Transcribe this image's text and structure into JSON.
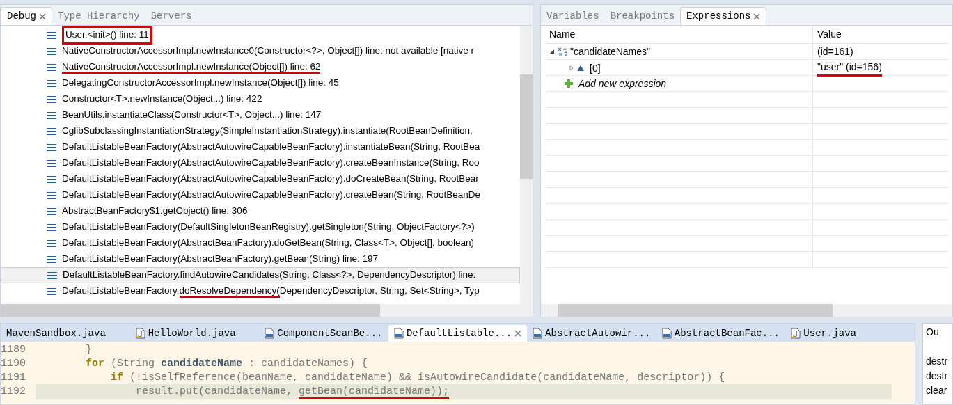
{
  "debug_panel": {
    "tabs": [
      {
        "label": "Debug",
        "selected": true,
        "closable": true
      },
      {
        "label": "Type Hierarchy",
        "selected": false,
        "closable": false
      },
      {
        "label": "Servers",
        "selected": false,
        "closable": false
      }
    ],
    "frames": [
      {
        "parts": [
          {
            "text": "User.<init>() line: 11",
            "underlined": false
          }
        ],
        "boxed": true,
        "selected": false
      },
      {
        "parts": [
          {
            "text": "NativeConstructorAccessorImpl.newInstance0(Constructor<?>, Object[]) line: not available [native r",
            "underlined": false
          }
        ],
        "boxed": false,
        "selected": false
      },
      {
        "parts": [
          {
            "text": "NativeConstructorAccessorImpl.newInstance(Object[]) line: 62",
            "underlined": true
          }
        ],
        "boxed": false,
        "selected": false
      },
      {
        "parts": [
          {
            "text": "DelegatingConstructorAccessorImpl.newInstance(Object[]) line: 45",
            "underlined": false
          }
        ],
        "boxed": false,
        "selected": false
      },
      {
        "parts": [
          {
            "text": "Constructor<T>.newInstance(Object...) line: 422",
            "underlined": false
          }
        ],
        "boxed": false,
        "selected": false
      },
      {
        "parts": [
          {
            "text": "BeanUtils.instantiateClass(Constructor<T>, Object...) line: 147",
            "underlined": false
          }
        ],
        "boxed": false,
        "selected": false
      },
      {
        "parts": [
          {
            "text": "CglibSubclassingInstantiationStrategy(SimpleInstantiationStrategy).instantiate(RootBeanDefinition,",
            "underlined": false
          }
        ],
        "boxed": false,
        "selected": false
      },
      {
        "parts": [
          {
            "text": "DefaultListableBeanFactory(AbstractAutowireCapableBeanFactory).instantiateBean(String, RootBea",
            "underlined": false
          }
        ],
        "boxed": false,
        "selected": false
      },
      {
        "parts": [
          {
            "text": "DefaultListableBeanFactory(AbstractAutowireCapableBeanFactory).createBeanInstance(String, Roo",
            "underlined": false
          }
        ],
        "boxed": false,
        "selected": false
      },
      {
        "parts": [
          {
            "text": "DefaultListableBeanFactory(AbstractAutowireCapableBeanFactory).doCreateBean(String, RootBear",
            "underlined": false
          }
        ],
        "boxed": false,
        "selected": false
      },
      {
        "parts": [
          {
            "text": "DefaultListableBeanFactory(AbstractAutowireCapableBeanFactory).createBean(String, RootBeanDe",
            "underlined": false
          }
        ],
        "boxed": false,
        "selected": false
      },
      {
        "parts": [
          {
            "text": "AbstractBeanFactory$1.getObject() line: 306",
            "underlined": false
          }
        ],
        "boxed": false,
        "selected": false
      },
      {
        "parts": [
          {
            "text": "DefaultListableBeanFactory(DefaultSingletonBeanRegistry).getSingleton(String, ObjectFactory<?>)",
            "underlined": false
          }
        ],
        "boxed": false,
        "selected": false
      },
      {
        "parts": [
          {
            "text": "DefaultListableBeanFactory(AbstractBeanFactory).doGetBean(String, Class<T>, Object[], boolean)",
            "underlined": false
          }
        ],
        "boxed": false,
        "selected": false
      },
      {
        "parts": [
          {
            "text": "DefaultListableBeanFactory(AbstractBeanFactory).getBean(String) line: 197",
            "underlined": false
          }
        ],
        "boxed": false,
        "selected": false
      },
      {
        "parts": [
          {
            "text": "DefaultListableBeanFactory.findAutowireCandidates(String, Class<?>, DependencyDescriptor) line:",
            "underlined": false
          }
        ],
        "boxed": false,
        "selected": true
      },
      {
        "parts": [
          {
            "text": "DefaultListableBeanFactory.",
            "underlined": false
          },
          {
            "text": "doResolveDependency(",
            "underlined": true
          },
          {
            "text": "DependencyDescriptor, String, Set<String>, Typ",
            "underlined": false
          }
        ],
        "boxed": false,
        "selected": false
      }
    ]
  },
  "expressions_panel": {
    "tabs": [
      {
        "label": "Variables",
        "selected": false,
        "closable": false
      },
      {
        "label": "Breakpoints",
        "selected": false,
        "closable": false
      },
      {
        "label": "Expressions",
        "selected": true,
        "closable": true
      }
    ],
    "columns": [
      "Name",
      "Value"
    ],
    "rows": [
      {
        "kind": "expression",
        "name": "\"candidateNames\"",
        "value": "(id=161)",
        "expanded": true,
        "underlined": false
      },
      {
        "kind": "element",
        "name": "[0]",
        "value": "\"user\" (id=156)",
        "expanded": false,
        "underlined": true
      },
      {
        "kind": "add",
        "name": "Add new expression"
      }
    ]
  },
  "editor": {
    "tabs": [
      {
        "label": "MavenSandbox.java",
        "kind": "java",
        "selected": false
      },
      {
        "label": "HelloWorld.java",
        "kind": "java-warning",
        "selected": false
      },
      {
        "label": "ComponentScanBe...",
        "kind": "class",
        "selected": false
      },
      {
        "label": "DefaultListable...",
        "kind": "class",
        "selected": true
      },
      {
        "label": "AbstractAutowir...",
        "kind": "class",
        "selected": false
      },
      {
        "label": "AbstractBeanFac...",
        "kind": "class",
        "selected": false
      },
      {
        "label": "User.java",
        "kind": "java-warning",
        "selected": false
      }
    ],
    "lines": [
      {
        "number": "1189",
        "current": false,
        "segments": [
          {
            "text": "        }",
            "kind": "plain",
            "underlined": false
          }
        ]
      },
      {
        "number": "1190",
        "current": false,
        "segments": [
          {
            "text": "        for",
            "kind": "keyword",
            "underlined": false
          },
          {
            "text": " (String ",
            "kind": "plain",
            "underlined": false
          },
          {
            "text": "candidateName",
            "kind": "variable",
            "underlined": false
          },
          {
            "text": " : candidateNames) {",
            "kind": "plain",
            "underlined": false
          }
        ]
      },
      {
        "number": "1191",
        "current": false,
        "segments": [
          {
            "text": "            if",
            "kind": "keyword",
            "underlined": false
          },
          {
            "text": " (!isSelfReference(beanName, candidateName) && isAutowireCandidate(candidateName, descriptor)) {",
            "kind": "plain",
            "underlined": false
          }
        ]
      },
      {
        "number": "1192",
        "current": true,
        "segments": [
          {
            "text": "                result.put(candidateName, ",
            "kind": "plain",
            "underlined": false
          },
          {
            "text": "getBean(candidateName));",
            "kind": "plain",
            "underlined": true
          }
        ]
      }
    ]
  },
  "outline_panel": {
    "tab": "Ou",
    "items": [
      "destr",
      "destr",
      "clear"
    ]
  }
}
